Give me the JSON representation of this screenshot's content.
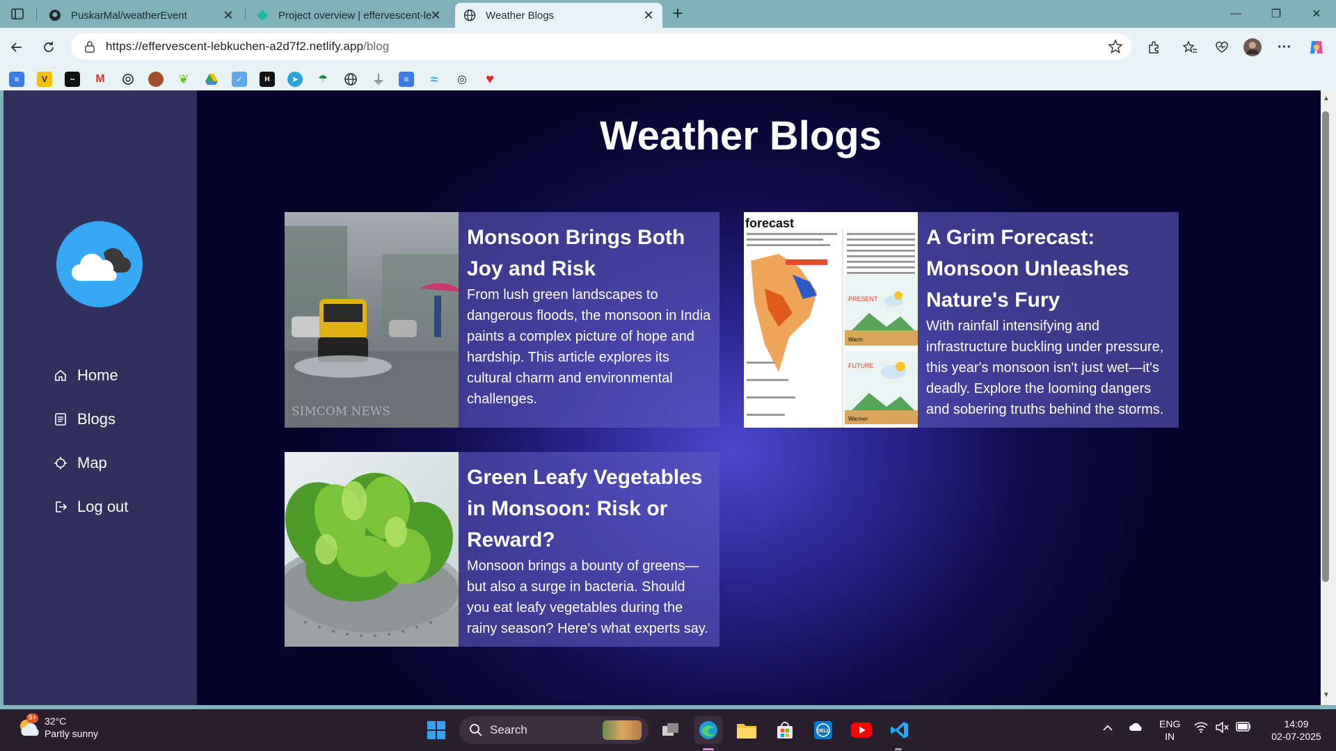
{
  "browser": {
    "tabs": [
      {
        "title": "PuskarMal/weatherEvent",
        "icon": "github-icon"
      },
      {
        "title": "Project overview | effervescent-lel",
        "icon": "netlify-icon"
      },
      {
        "title": "Weather Blogs",
        "icon": "globe-icon",
        "active": true
      }
    ],
    "url_host": "https://effervescent-lebkuchen-a2d7f2.netlify.app",
    "url_path": "/blog"
  },
  "sidebar": {
    "nav": [
      {
        "label": "Home",
        "icon": "home-icon"
      },
      {
        "label": "Blogs",
        "icon": "document-icon"
      },
      {
        "label": "Map",
        "icon": "map-pin-icon"
      },
      {
        "label": "Log out",
        "icon": "logout-icon"
      }
    ]
  },
  "main": {
    "title": "Weather Blogs",
    "posts": [
      {
        "title": "Monsoon Brings Both Joy and Risk",
        "summary": "From lush green landscapes to dangerous floods, the monsoon in India paints a complex picture of hope and hardship. This article explores its cultural charm and environmental challenges.",
        "image": "monsoon-rain-street-photo",
        "watermark": "SIMCOM NEWS"
      },
      {
        "title": "A Grim Forecast: Monsoon Unleashes Nature's Fury",
        "summary": "With rainfall intensifying and infrastructure buckling under pressure, this year's monsoon isn't just wet—it's deadly. Explore the looming dangers and sobering truths behind the storms.",
        "image": "forecast-infographic",
        "image_label": "forecast",
        "present_label": "PRESENT",
        "future_label": "FUTURE",
        "warm_label": "Warm",
        "warmer_label": "Warmer"
      },
      {
        "title": "Green Leafy Vegetables in Monsoon: Risk or Reward?",
        "summary": "Monsoon brings a bounty of greens—but also a surge in bacteria. Should you eat leafy vegetables during the rainy season? Here's what experts say.",
        "image": "leafy-greens-photo"
      }
    ]
  },
  "taskbar": {
    "weather_temp": "32°C",
    "weather_desc": "Partly sunny",
    "weather_badge": "9+",
    "search_label": "Search",
    "lang_top": "ENG",
    "lang_bottom": "IN",
    "time": "14:09",
    "date": "02-07-2025"
  },
  "colors": {
    "sidebar": "#30305f",
    "logo": "#36a8f4",
    "card": "#5c58be"
  }
}
